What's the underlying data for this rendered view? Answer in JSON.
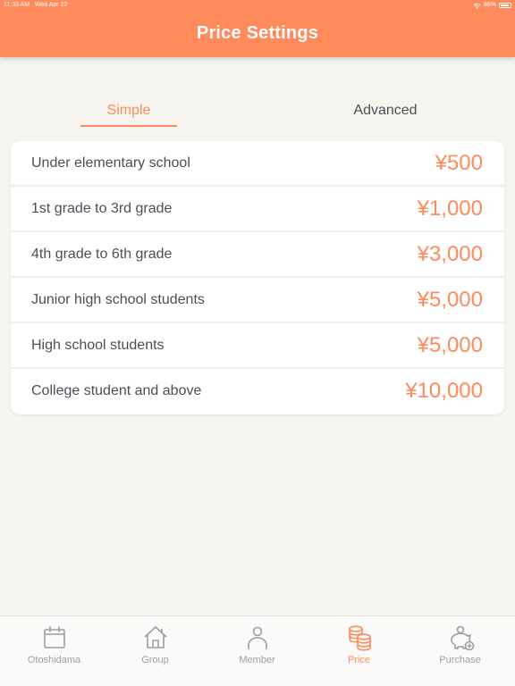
{
  "status": {
    "time": "11:33 AM",
    "date": "Wed Apr 22",
    "battery": "86%",
    "battery_level": 0.86
  },
  "header": {
    "title": "Price Settings"
  },
  "segments": {
    "simple": "Simple",
    "advanced": "Advanced",
    "selected": "Simple"
  },
  "prices": [
    {
      "label": "Under elementary school",
      "price": "¥500"
    },
    {
      "label": "1st grade to 3rd grade",
      "price": "¥1,000"
    },
    {
      "label": "4th grade to 6th grade",
      "price": "¥3,000"
    },
    {
      "label": "Junior high school students",
      "price": "¥5,000"
    },
    {
      "label": "High school students",
      "price": "¥5,000"
    },
    {
      "label": "College student and above",
      "price": "¥10,000"
    }
  ],
  "tabs": [
    {
      "label": "Otoshidama",
      "icon": "calendar-icon"
    },
    {
      "label": "Group",
      "icon": "house-icon"
    },
    {
      "label": "Member",
      "icon": "person-icon"
    },
    {
      "label": "Price",
      "icon": "coins-icon",
      "active": true
    },
    {
      "label": "Purchase",
      "icon": "piggy-bank-icon"
    }
  ],
  "colors": {
    "accent": "#ff8a5c",
    "text": "#4a4f57",
    "inactive": "#9a9ea5",
    "background": "#f6f4ef"
  }
}
